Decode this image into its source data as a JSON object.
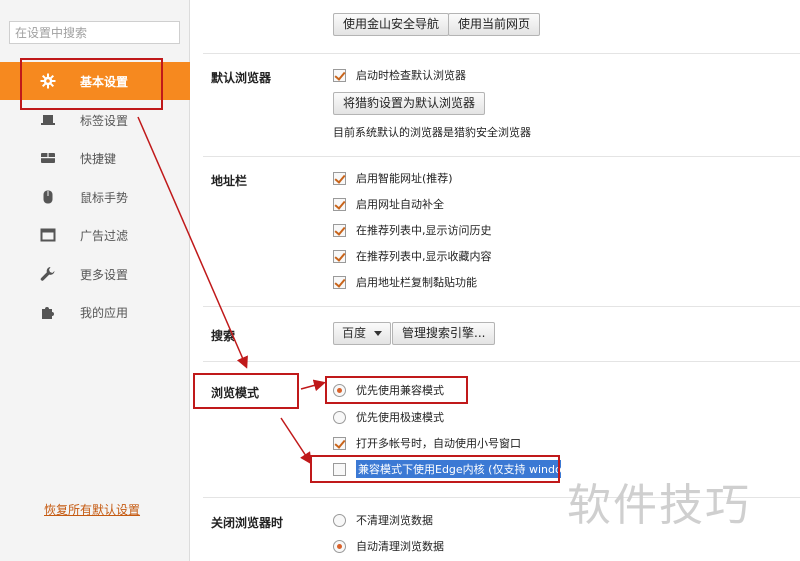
{
  "sidebar": {
    "search_placeholder": "在设置中搜索",
    "items": [
      {
        "label": "基本设置",
        "icon": "gear-icon",
        "active": true
      },
      {
        "label": "标签设置",
        "icon": "laptop-icon"
      },
      {
        "label": "快捷键",
        "icon": "keyboard-icon"
      },
      {
        "label": "鼠标手势",
        "icon": "mouse-icon"
      },
      {
        "label": "广告过滤",
        "icon": "window-icon"
      },
      {
        "label": "更多设置",
        "icon": "wrench-icon"
      },
      {
        "label": "我的应用",
        "icon": "puzzle-icon"
      }
    ],
    "restore_label": "恢复所有默认设置"
  },
  "startup": {
    "btn_nav": "使用金山安全导航",
    "btn_current": "使用当前网页"
  },
  "default_browser": {
    "label": "默认浏览器",
    "check_label": "启动时检查默认浏览器",
    "set_button": "将猎豹设置为默认浏览器",
    "status": "目前系统默认的浏览器是猎豹安全浏览器"
  },
  "address_bar": {
    "label": "地址栏",
    "options": [
      "启用智能网址(推荐)",
      "启用网址自动补全",
      "在推荐列表中,显示访问历史",
      "在推荐列表中,显示收藏内容",
      "启用地址栏复制黏贴功能"
    ]
  },
  "search": {
    "label": "搜索",
    "engine": "百度",
    "manage_button": "管理搜索引擎..."
  },
  "browse_mode": {
    "label": "浏览模式",
    "radio_compat": "优先使用兼容模式",
    "radio_fast": "优先使用极速模式",
    "multi_account": "打开多帐号时，自动使用小号窗口",
    "edge_core": "兼容模式下使用Edge内核 (仅支持 windo"
  },
  "on_close": {
    "label": "关闭浏览器时",
    "radio_no_clear": "不清理浏览数据",
    "radio_auto_clear": "自动清理浏览数据"
  },
  "watermark": "软件技巧",
  "colors": {
    "accent": "#f6891f",
    "annotation": "#c0191a",
    "highlight": "#3b79d4"
  }
}
